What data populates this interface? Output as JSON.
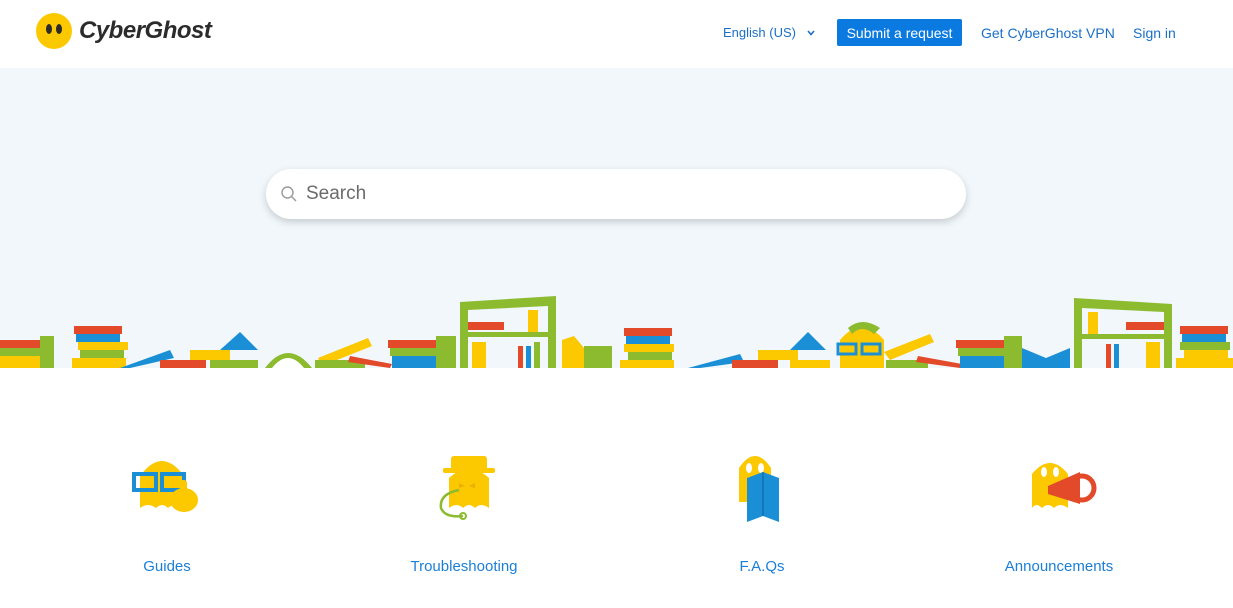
{
  "header": {
    "brand": "CyberGhost",
    "language": "English (US)",
    "submit_label": "Submit a request",
    "get_vpn_label": "Get CyberGhost VPN",
    "signin_label": "Sign in"
  },
  "search": {
    "placeholder": "Search"
  },
  "categories": [
    {
      "label": "Guides",
      "icon": "ghost-glasses-icon"
    },
    {
      "label": "Troubleshooting",
      "icon": "ghost-detective-icon"
    },
    {
      "label": "F.A.Qs",
      "icon": "ghost-book-icon"
    },
    {
      "label": "Announcements",
      "icon": "ghost-megaphone-icon"
    }
  ],
  "colors": {
    "accent": "#0a7ae0",
    "link": "#1b6fc7",
    "hero_bg": "#f1f7fb",
    "ghost_yellow": "#fcc800"
  }
}
